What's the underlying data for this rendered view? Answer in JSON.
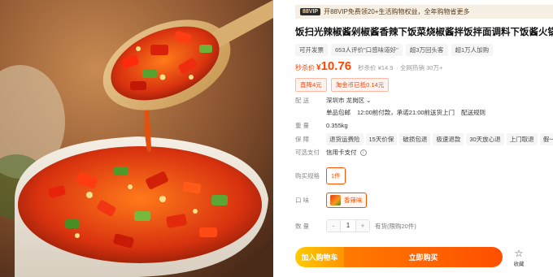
{
  "vip_bar": {
    "tag": "88VIP",
    "text": "开88VIP免费领20+生活购物权益，全年购物省更多"
  },
  "product": {
    "title": "饭扫光辣椒酱剁椒酱香辣下饭菜烧椒酱拌饭拌面调料下饭酱火锅蘸料",
    "tags": [
      "可开发票",
      "653人评价\"口感味道好\"",
      "超3万回头客",
      "超1万人加购"
    ]
  },
  "price": {
    "label": "秒杀价",
    "currency": "¥",
    "amount": "10.76",
    "original": "秒杀价 ¥14.9",
    "sales": "· 全网热销 30万+"
  },
  "promos": [
    "直降4元",
    "淘金币已抵0.14元"
  ],
  "delivery": {
    "label": "配  送",
    "location": "深圳市 龙岗区",
    "chevron": "⌄",
    "shipping_free": "单品包邮",
    "cutoff": "12:00前付款，承诺21:00前送货上门",
    "rules": "配送规则"
  },
  "weight": {
    "label": "重  量",
    "value": "0.355kg"
  },
  "guarantee": {
    "label": "保  障",
    "items": [
      "退货运费险",
      "15天价保",
      "破损包退",
      "极速退款",
      "30天放心退",
      "上门取退",
      "假一赔十"
    ]
  },
  "payment": {
    "label": "可选支付",
    "value": "信用卡支付",
    "info_icon": "info-icon"
  },
  "spec": {
    "label": "购买规格",
    "selected": "1件"
  },
  "flavor": {
    "label": "口  味",
    "selected": "香辣味"
  },
  "quantity": {
    "label": "数  量",
    "minus": "-",
    "value": "1",
    "plus": "+",
    "stock": "有货(限购20件)"
  },
  "actions": {
    "cart": "加入购物车",
    "buy": "立即购买",
    "favorite": "收藏",
    "favorite_icon": "star-icon"
  }
}
